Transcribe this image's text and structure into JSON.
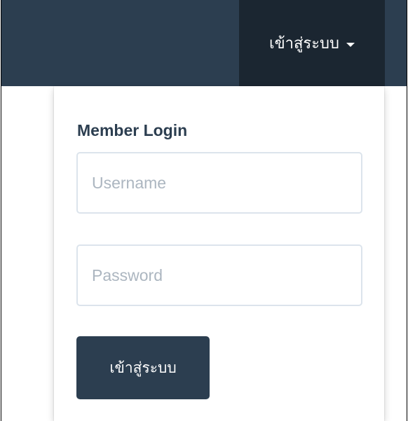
{
  "navbar": {
    "login_toggle_label": "เข้าสู่ระบบ",
    "background_color": "#2c3e50",
    "active_color": "#1b2631"
  },
  "login_dropdown": {
    "title": "Member Login",
    "username_placeholder": "Username",
    "username_value": "",
    "password_placeholder": "Password",
    "password_value": "",
    "submit_label": "เข้าสู่ระบบ",
    "button_color": "#2c3e50",
    "input_border_color": "#dce4ec"
  }
}
